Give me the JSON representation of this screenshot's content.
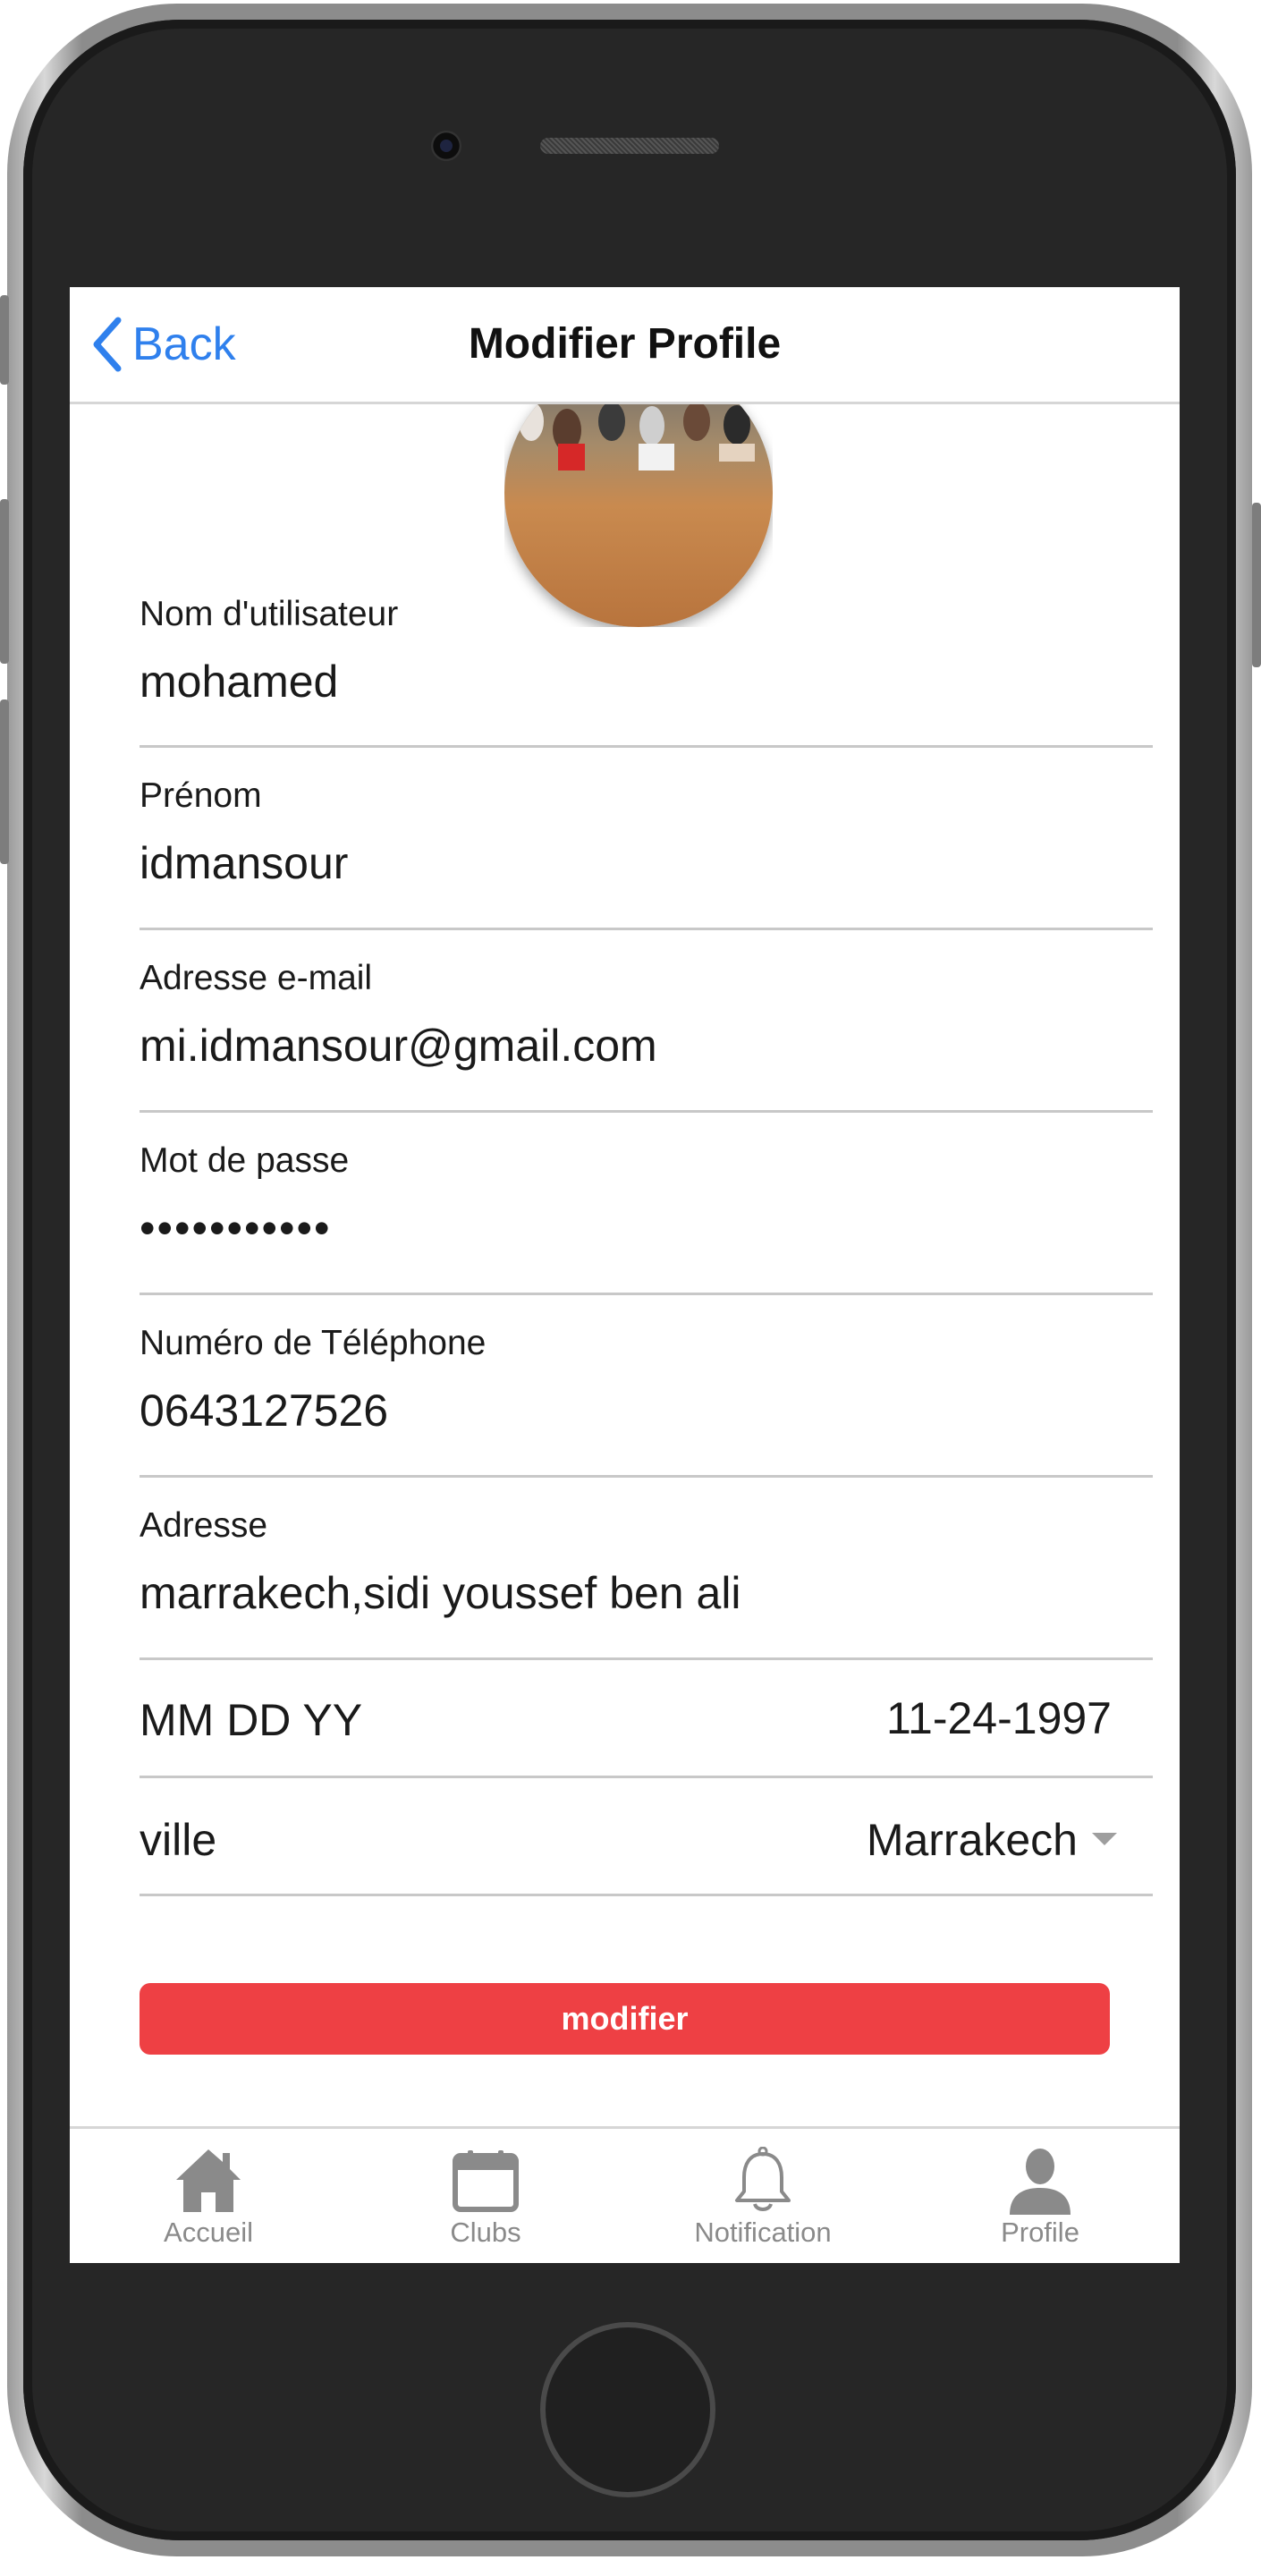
{
  "header": {
    "back_label": "Back",
    "title": "Modifier Profile"
  },
  "form": {
    "username": {
      "label": "Nom d'utilisateur",
      "value": "mohamed"
    },
    "firstname": {
      "label": "Prénom",
      "value": "idmansour"
    },
    "email": {
      "label": "Adresse e-mail",
      "value": "mi.idmansour@gmail.com"
    },
    "password": {
      "label": "Mot de passe",
      "value": "•••••••••••"
    },
    "phone": {
      "label": "Numéro de Téléphone",
      "value": "0643127526"
    },
    "address": {
      "label": "Adresse",
      "value": "marrakech,sidi youssef ben ali"
    },
    "date": {
      "label": "MM DD YY",
      "value": "11-24-1997"
    },
    "city": {
      "label": "ville",
      "value": "Marrakech"
    }
  },
  "submit_label": "modifier",
  "tabs": [
    {
      "label": "Accueil",
      "icon": "home-icon"
    },
    {
      "label": "Clubs",
      "icon": "calendar-icon"
    },
    {
      "label": "Notification",
      "icon": "bell-icon"
    },
    {
      "label": "Profile",
      "icon": "person-icon"
    }
  ],
  "colors": {
    "accent": "#2f80ed",
    "button": "#ee4044",
    "tab_inactive": "#8a8a8a"
  }
}
